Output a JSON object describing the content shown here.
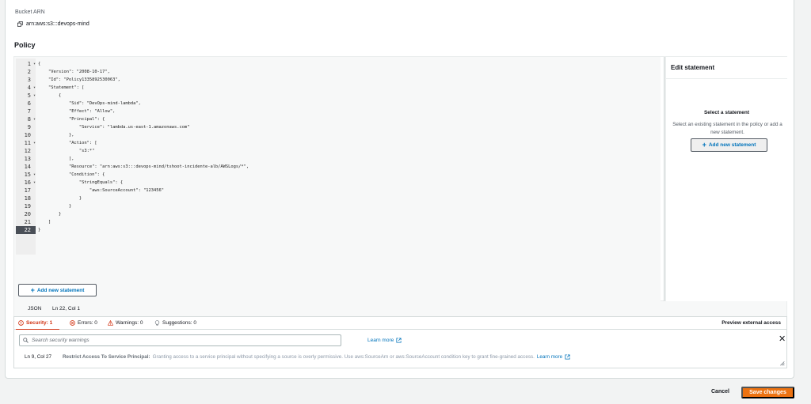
{
  "bucket": {
    "arn_label": "Bucket ARN",
    "arn_value": "arn:aws:s3:::devops-mind",
    "copy_icon": "copy-icon"
  },
  "policy": {
    "title": "Policy",
    "add_statement_label": "Add new statement",
    "active_line": 22,
    "lines": [
      {
        "num": "1",
        "fold": true,
        "text": "{"
      },
      {
        "num": "2",
        "fold": false,
        "text": "    \"Version\": \"2008-10-17\","
      },
      {
        "num": "3",
        "fold": false,
        "text": "    \"Id\": \"Policy1335892530063\","
      },
      {
        "num": "4",
        "fold": true,
        "text": "    \"Statement\": ["
      },
      {
        "num": "5",
        "fold": true,
        "text": "        {"
      },
      {
        "num": "6",
        "fold": false,
        "text": "            \"Sid\": \"DevOps-mind-lambda\","
      },
      {
        "num": "7",
        "fold": false,
        "text": "            \"Effect\": \"Allow\","
      },
      {
        "num": "8",
        "fold": true,
        "text": "            \"Principal\": {"
      },
      {
        "num": "9",
        "fold": false,
        "text": "                \"Service\": \"lambda.us-east-1.amazonaws.com\""
      },
      {
        "num": "10",
        "fold": false,
        "text": "            },"
      },
      {
        "num": "11",
        "fold": true,
        "text": "            \"Action\": ["
      },
      {
        "num": "12",
        "fold": false,
        "text": "                \"s3:*\""
      },
      {
        "num": "13",
        "fold": false,
        "text": "            ],"
      },
      {
        "num": "14",
        "fold": false,
        "text": "            \"Resource\": \"arn:aws:s3:::devops-mind/tshoot-incidente-alb/AWSLogs/*\","
      },
      {
        "num": "15",
        "fold": true,
        "text": "            \"Condition\": {"
      },
      {
        "num": "16",
        "fold": true,
        "text": "                \"StringEquals\": {"
      },
      {
        "num": "17",
        "fold": false,
        "text": "                    \"aws:SourceAccount\": \"123456\""
      },
      {
        "num": "18",
        "fold": false,
        "text": "                }"
      },
      {
        "num": "19",
        "fold": false,
        "text": "            }"
      },
      {
        "num": "20",
        "fold": false,
        "text": "        }"
      },
      {
        "num": "21",
        "fold": false,
        "text": "    ]"
      },
      {
        "num": "22",
        "fold": false,
        "text": "}"
      }
    ]
  },
  "side_panel": {
    "title": "Edit statement",
    "select_title": "Select a statement",
    "select_desc": "Select an existing statement in the policy or add a new statement.",
    "add_label": "Add new statement"
  },
  "status": {
    "language": "JSON",
    "position": "Ln 22, Col 1"
  },
  "tabs": {
    "security": "Security: 1",
    "errors": "Errors: 0",
    "warnings": "Warnings: 0",
    "suggestions": "Suggestions: 0",
    "preview": "Preview external access"
  },
  "warnings_panel": {
    "search_placeholder": "Search security warnings",
    "learn_more": "Learn more",
    "finding": {
      "location": "Ln 9, Col 27",
      "title": "Restrict Access To Service Principal:",
      "description": "Granting access to a service principal without specifying a source is overly permissive. Use aws:SourceArn or aws:SourceAccount condition key to grant fine-grained access.",
      "link": "Learn more"
    }
  },
  "footer": {
    "cancel": "Cancel",
    "save": "Save changes"
  },
  "colors": {
    "accent": "#0073bb",
    "security_red": "#d13212",
    "primary_orange": "#ec7211"
  }
}
